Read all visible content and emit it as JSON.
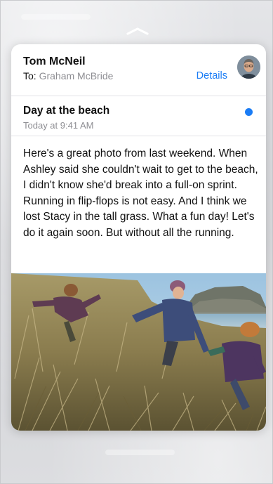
{
  "message": {
    "sender": "Tom McNeil",
    "to_prefix": "To:",
    "recipient": "Graham McBride",
    "details_label": "Details",
    "subject": "Day at the beach",
    "time": "Today at 9:41 AM",
    "body": "Here's a great photo from last weekend. When Ashley said she couldn't wait to get to the beach, I didn't know she'd break into a full-on sprint. Running in flip-flops is not easy. And I think we lost Stacy in the tall grass. What a fun day! Let's do it again soon. But without all the running."
  },
  "colors": {
    "accent": "#1a7cf5",
    "secondary_text": "#8e8e93"
  },
  "icons": {
    "peek_indicator": "chevron-up-icon",
    "unread": "unread-dot-icon"
  }
}
